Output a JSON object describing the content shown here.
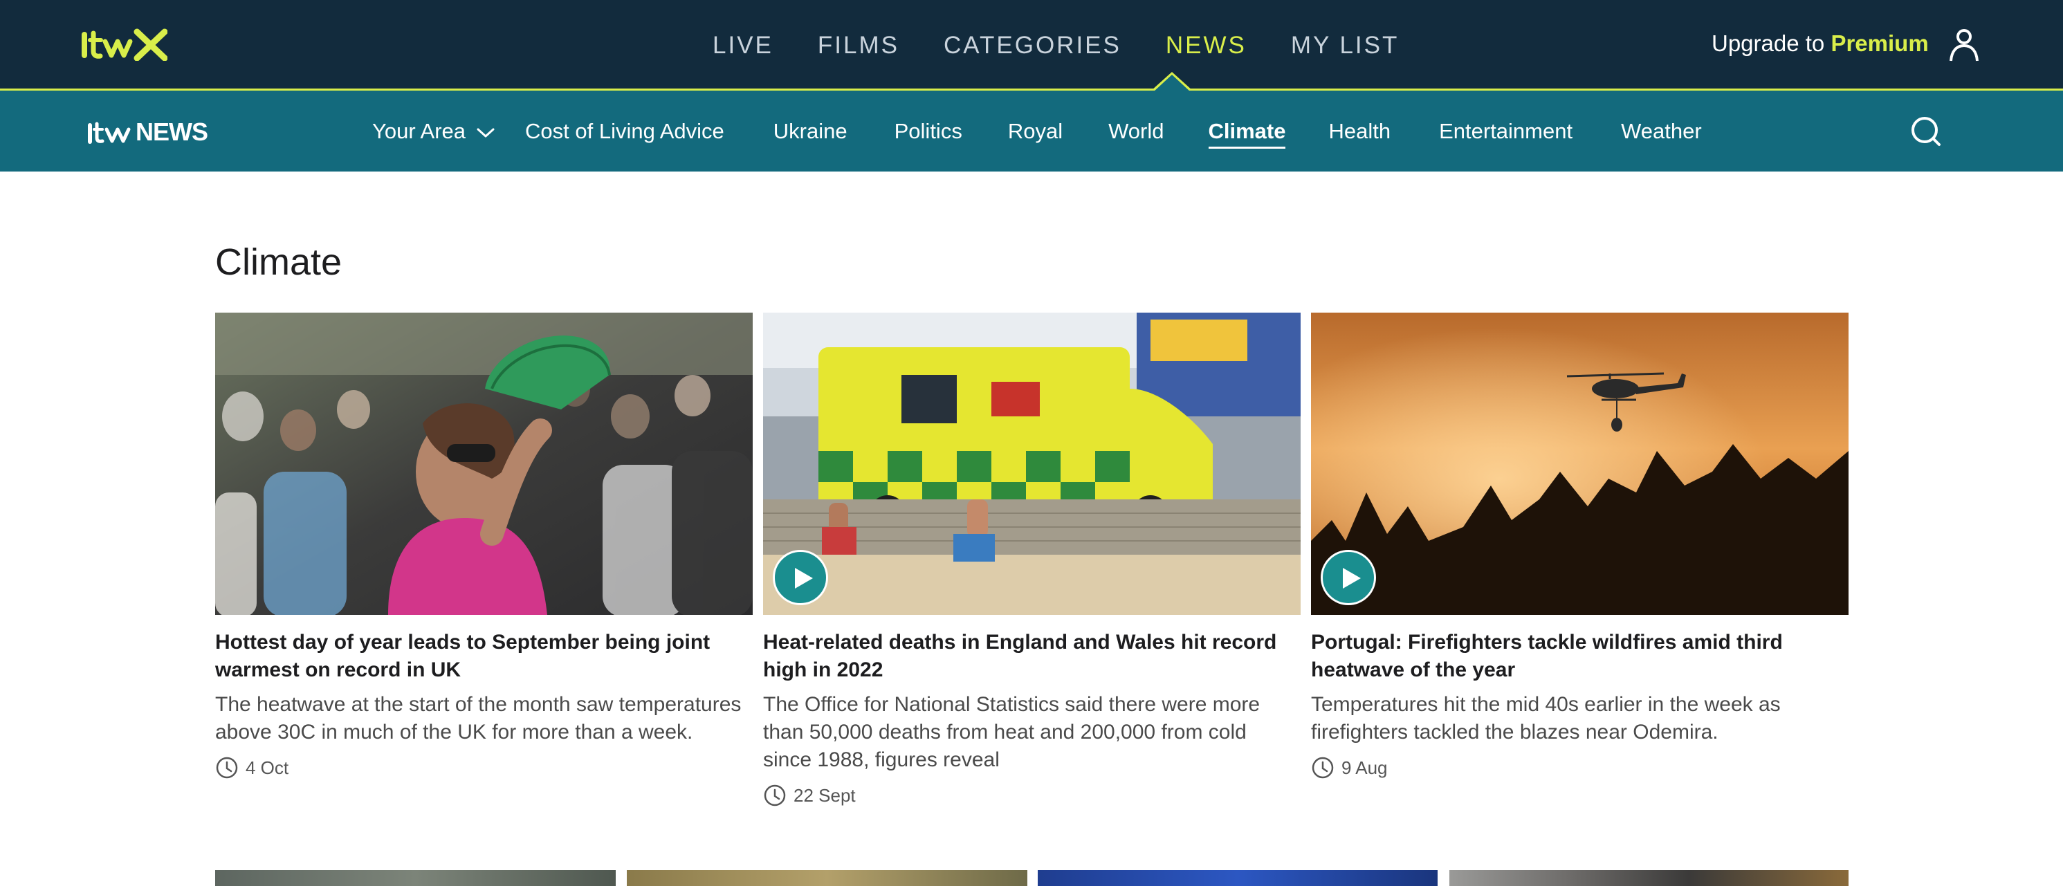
{
  "topbar": {
    "logo_text": "itvX",
    "nav": [
      "LIVE",
      "FILMS",
      "CATEGORIES",
      "NEWS",
      "MY LIST"
    ],
    "active_nav": "NEWS",
    "upgrade_prefix": "Upgrade to",
    "upgrade_premium": "Premium",
    "accent_color": "#d9ee4a",
    "background_color": "#122b3d"
  },
  "subbar": {
    "logo_itv": "itv",
    "logo_news": "NEWS",
    "your_area": "Your Area",
    "links": [
      "Cost of Living Advice",
      "Ukraine",
      "Politics",
      "Royal",
      "World",
      "Climate",
      "Health",
      "Entertainment",
      "Weather"
    ],
    "active_link": "Climate",
    "background_color": "#136a7d"
  },
  "page": {
    "title": "Climate"
  },
  "articles": [
    {
      "headline": "Hottest day of year leads to September being joint warmest on record in UK",
      "summary": "The heatwave at the start of the month saw temperatures above 30C in much of the UK for more than a week.",
      "date": "4 Oct",
      "has_video": false
    },
    {
      "headline": "Heat-related deaths in England and Wales hit record high in 2022",
      "summary": "The Office for National Statistics said there were more than 50,000 deaths from heat and 200,000 from cold since 1988, figures reveal",
      "date": "22 Sept",
      "has_video": true
    },
    {
      "headline": "Portugal: Firefighters tackle wildfires amid third heatwave of the year",
      "summary": "Temperatures hit the mid 40s earlier in the week as firefighters tackled the blazes near Odemira.",
      "date": "9 Aug",
      "has_video": true
    }
  ],
  "icons": {
    "account": "account-icon",
    "search": "search-icon",
    "clock": "clock-icon",
    "play": "play-icon",
    "chevron": "chevron-down-icon"
  }
}
